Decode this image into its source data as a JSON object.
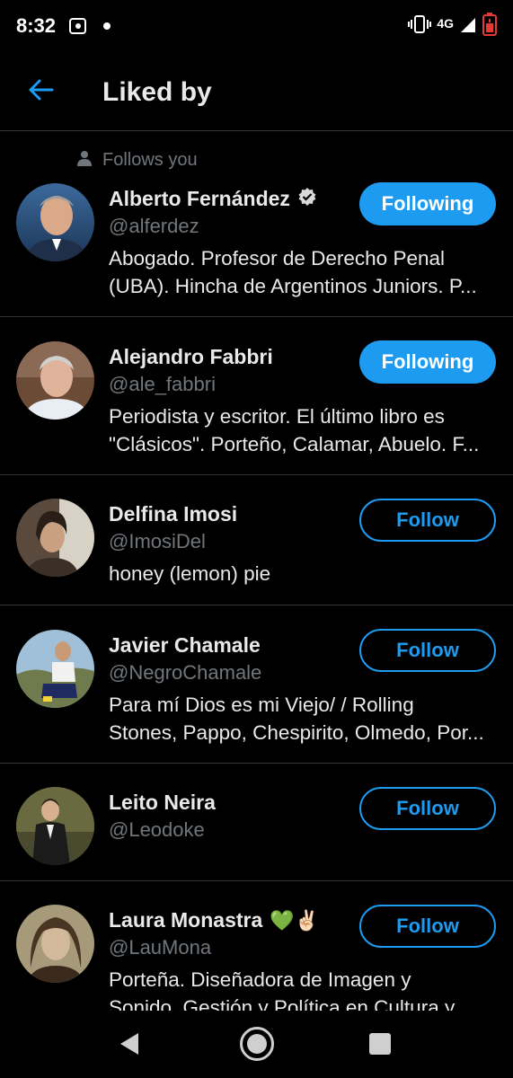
{
  "status_bar": {
    "time": "8:32",
    "network": "4G",
    "icons": [
      "app-notification-icon",
      "vibrate-icon",
      "signal-icon",
      "battery-low-icon"
    ]
  },
  "header": {
    "back_icon": "arrow-left-icon",
    "title": "Liked by"
  },
  "follows_you_label": "Follows you",
  "users": [
    {
      "name": "Alberto Fernández",
      "verified": true,
      "handle": "@alferdez",
      "bio_lines": [
        "Abogado. Profesor de Derecho Penal",
        "(UBA). Hincha de Argentinos Juniors. P..."
      ],
      "button": "Following"
    },
    {
      "name": "Alejandro Fabbri",
      "handle": "@ale_fabbri",
      "bio_lines": [
        "Periodista y escritor. El último libro es",
        "\"Clásicos\". Porteño, Calamar, Abuelo. F..."
      ],
      "button": "Following"
    },
    {
      "name": "Delfina Imosi",
      "handle": "@ImosiDel",
      "bio_lines": [
        "honey (lemon) pie"
      ],
      "button": "Follow"
    },
    {
      "name": "Javier Chamale",
      "handle": "@NegroChamale",
      "bio_lines": [
        "Para mí Dios es mi Viejo/ / Rolling",
        "Stones, Pappo, Chespirito, Olmedo, Por..."
      ],
      "button": "Follow"
    },
    {
      "name": "Leito Neira",
      "handle": "@Leodoke",
      "bio_lines": [],
      "button": "Follow"
    },
    {
      "name": "Laura Monastra",
      "name_emoji": "💚✌🏻",
      "handle": "@LauMona",
      "bio_lines": [
        "Porteña. Diseñadora de Imagen y",
        "Sonido. Gestión y Política en Cultura y..."
      ],
      "button": "Follow"
    }
  ],
  "colors": {
    "background": "#000000",
    "accent": "#1d9bf0",
    "secondary_text": "#71767b",
    "divider": "#2f3336"
  },
  "nav_bar": {
    "icons": [
      "nav-back-icon",
      "nav-home-icon",
      "nav-recents-icon"
    ]
  }
}
